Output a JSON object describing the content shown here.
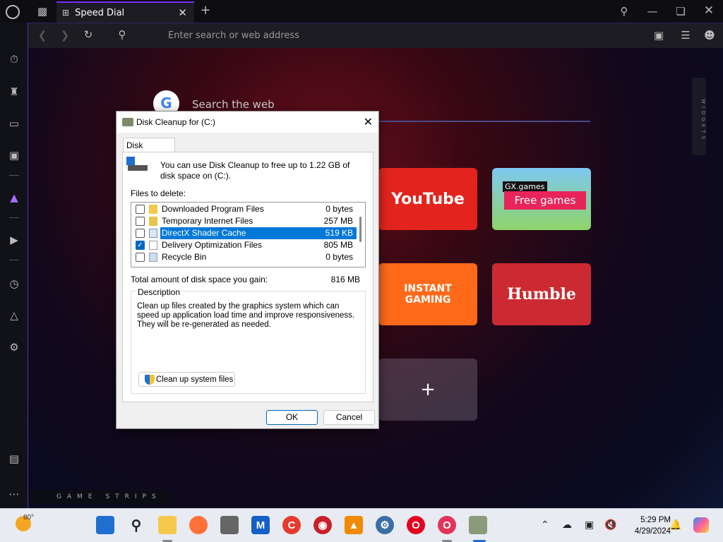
{
  "browser": {
    "tab_title": "Speed Dial",
    "address_placeholder": "Enter search or web address",
    "search_the_web": "Search the web",
    "widgets_label": "WIDGETS",
    "game_strips": "GAME STRIPS"
  },
  "speed_dial": {
    "tiles": [
      {
        "name": "YouTube",
        "color": "#e3241e"
      },
      {
        "name": "GX.games",
        "color": "#7ec8f0",
        "label": "Free games"
      },
      {
        "name": "INSTANT GAMING",
        "color": "#ff6a1a"
      },
      {
        "name": "Humble",
        "color": "#cc2a32"
      }
    ],
    "add_label": "+"
  },
  "dialog": {
    "title": "Disk Cleanup for  (C:)",
    "tab": "Disk Cleanup",
    "intro": "You can use Disk Cleanup to free up to 1.22 GB of disk space on  (C:).",
    "files_to_delete_label": "Files to delete:",
    "files": [
      {
        "name": "Downloaded Program Files",
        "size": "0 bytes",
        "checked": false,
        "icon": "folder-icon"
      },
      {
        "name": "Temporary Internet Files",
        "size": "257 MB",
        "checked": false,
        "icon": "lock-icon"
      },
      {
        "name": "DirectX Shader Cache",
        "size": "519 KB",
        "checked": false,
        "icon": "document-icon",
        "selected": true
      },
      {
        "name": "Delivery Optimization Files",
        "size": "805 MB",
        "checked": true,
        "icon": "page-icon"
      },
      {
        "name": "Recycle Bin",
        "size": "0 bytes",
        "checked": false,
        "icon": "recycle-bin-icon"
      }
    ],
    "total_label": "Total amount of disk space you gain:",
    "total_value": "816 MB",
    "description_title": "Description",
    "description_text": "Clean up files created by the graphics system which can speed up application load time and improve responsiveness. They will be re-generated as needed.",
    "cleanup_system_button": "Clean up system files",
    "ok_button": "OK",
    "cancel_button": "Cancel"
  },
  "taskbar": {
    "temperature": "80°",
    "time": "5:29 PM",
    "date": "4/29/2024"
  }
}
